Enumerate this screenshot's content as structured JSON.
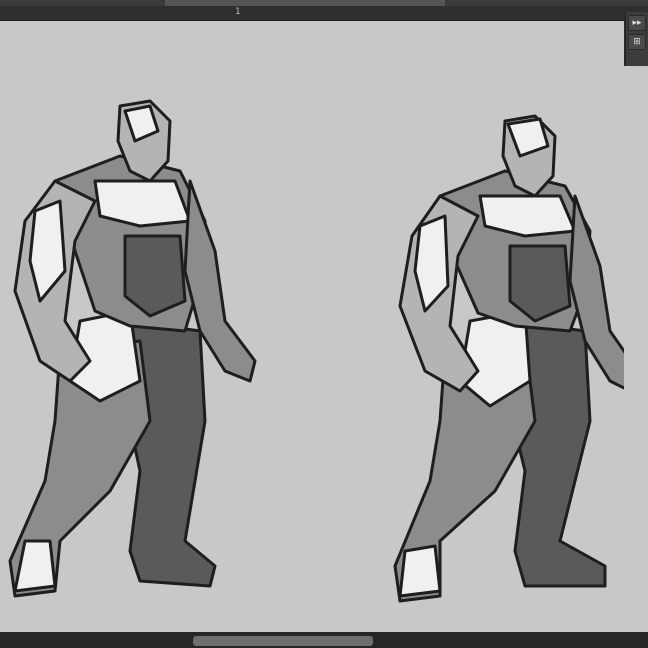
{
  "ruler": {
    "marker": "1"
  },
  "panel": {
    "collapse_glyph": "▸▸",
    "tool_glyph": "⊞"
  },
  "canvas": {
    "background": "#c8c8c8",
    "figures": [
      "figure-left",
      "figure-right"
    ]
  },
  "colors": {
    "outline": "#1e1e1e",
    "dark": "#5a5a5a",
    "mid": "#8c8c8c",
    "light": "#b4b4b4",
    "highlight": "#f0f0f0"
  }
}
